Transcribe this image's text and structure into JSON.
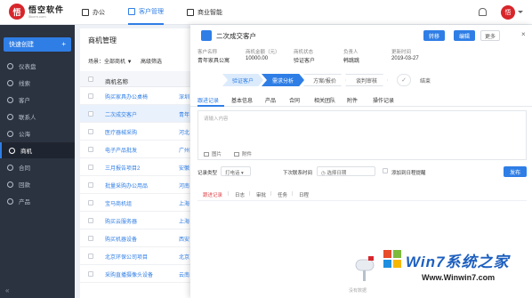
{
  "app": {
    "logo_mark": "悟",
    "logo_title": "悟空软件",
    "logo_sub": "5kcrm.com"
  },
  "topnav": [
    {
      "label": "办公",
      "icon": "office-icon"
    },
    {
      "label": "客户管理",
      "icon": "customer-icon"
    },
    {
      "label": "商业智能",
      "icon": "chart-icon"
    }
  ],
  "header": {
    "avatar_text": "悟"
  },
  "sidebar": {
    "quick_create": "快速创建",
    "quick_create_plus": "+",
    "items": [
      {
        "label": "仪表盘",
        "icon": "dashboard-icon"
      },
      {
        "label": "线索",
        "icon": "lead-icon"
      },
      {
        "label": "客户",
        "icon": "customer-icon"
      },
      {
        "label": "联系人",
        "icon": "contact-icon"
      },
      {
        "label": "公海",
        "icon": "pool-icon"
      },
      {
        "label": "商机",
        "icon": "opportunity-icon"
      },
      {
        "label": "合同",
        "icon": "contract-icon"
      },
      {
        "label": "回款",
        "icon": "payment-icon"
      },
      {
        "label": "产品",
        "icon": "product-icon"
      }
    ],
    "collapse_glyph": "«"
  },
  "list": {
    "title": "商机管理",
    "scene": "场景：全部商机 ▼",
    "filter": "高级筛选",
    "column_name": "商机名称",
    "rows": [
      {
        "name": "购买家具办公桌椅",
        "city": "深圳"
      },
      {
        "name": "二次成交客户",
        "city": "青年"
      },
      {
        "name": "医疗器械采购",
        "city": "河北"
      },
      {
        "name": "电子产品批发",
        "city": "广州"
      },
      {
        "name": "三月报告项目2",
        "city": "安徽"
      },
      {
        "name": "批量采购办公用品",
        "city": "河南"
      },
      {
        "name": "宝马商机组",
        "city": "上海"
      },
      {
        "name": "购买云服务器",
        "city": "上海"
      },
      {
        "name": "购买机器设备",
        "city": "西安"
      },
      {
        "name": "北京环保公司项目",
        "city": "北京"
      },
      {
        "name": "采购直播摄像头设备",
        "city": "云南"
      }
    ]
  },
  "detail": {
    "title": "二次成交客户",
    "buttons": {
      "transfer": "转移",
      "edit": "编辑",
      "more": "更多"
    },
    "close_glyph": "×",
    "info": [
      {
        "key": "客户名称",
        "value": "青年家具公寓"
      },
      {
        "key": "商机金额（元）",
        "value": "10000.00"
      },
      {
        "key": "商机状态",
        "value": "验证客户"
      },
      {
        "key": "负责人",
        "value": "韩跳跳"
      },
      {
        "key": "更新时间",
        "value": "2019-03-27"
      }
    ],
    "stages": [
      "验证客户",
      "需求分析",
      "方案/报价",
      "谈判审核"
    ],
    "stage_end": "✓",
    "stage_end_label": "结束",
    "tabs": [
      "跟进记录",
      "基本信息",
      "产品",
      "合同",
      "相关团队",
      "附件",
      "操作记录"
    ],
    "editor_placeholder": "请输入内容",
    "editor_tools": [
      "图片",
      "附件"
    ],
    "record_type_label": "记录类型",
    "record_type_value": "打电话 ▾",
    "next_contact_label": "下次联系时间",
    "next_contact_placeholder": "◷ 选择日期",
    "schedule_label": "添加到日程提醒",
    "publish": "发布",
    "filters": [
      "跟进记录",
      "日志",
      "审批",
      "任务",
      "日程"
    ],
    "filter_sep": "|",
    "empty_text": "没有数据"
  },
  "watermark": {
    "title": "Win7系统之家",
    "url": "Www.Winwin7.com"
  },
  "colors": {
    "accent": "#2f7ee6",
    "brand": "#d7262b",
    "sidebar": "#2b3240"
  }
}
